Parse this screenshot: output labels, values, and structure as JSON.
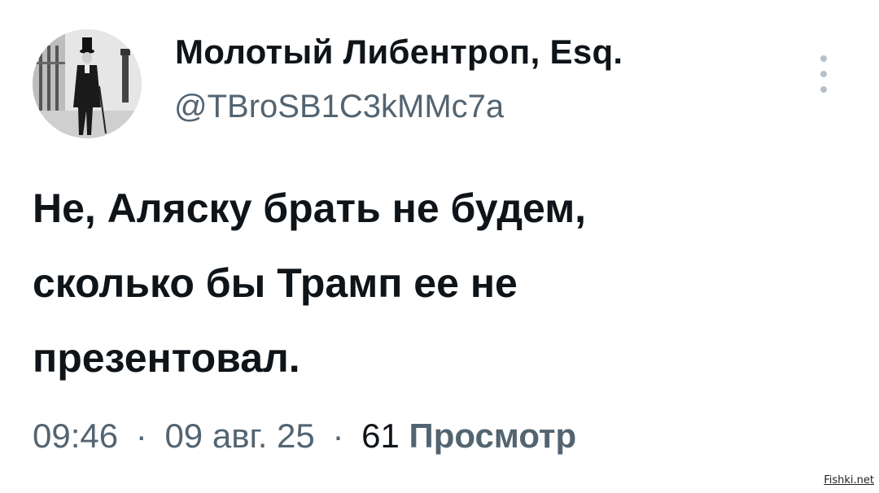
{
  "author": {
    "display_name": "Молотый Либентроп, Esq.",
    "handle": "@TBroSB1C3kMMc7a"
  },
  "tweet": {
    "lines": [
      "Не, Аляску брать не будем,",
      "сколько бы Трамп ее не",
      "презентовал."
    ],
    "time": "09:46",
    "separator": "·",
    "date": "09 авг. 25",
    "views_count": "61",
    "views_label": "Просмотр"
  },
  "watermark": "Fishki.net",
  "icons": {
    "more": "more-vertical-icon",
    "avatar": "avatar-photo"
  },
  "colors": {
    "primary_text": "#0f1419",
    "secondary_text": "#536471"
  }
}
